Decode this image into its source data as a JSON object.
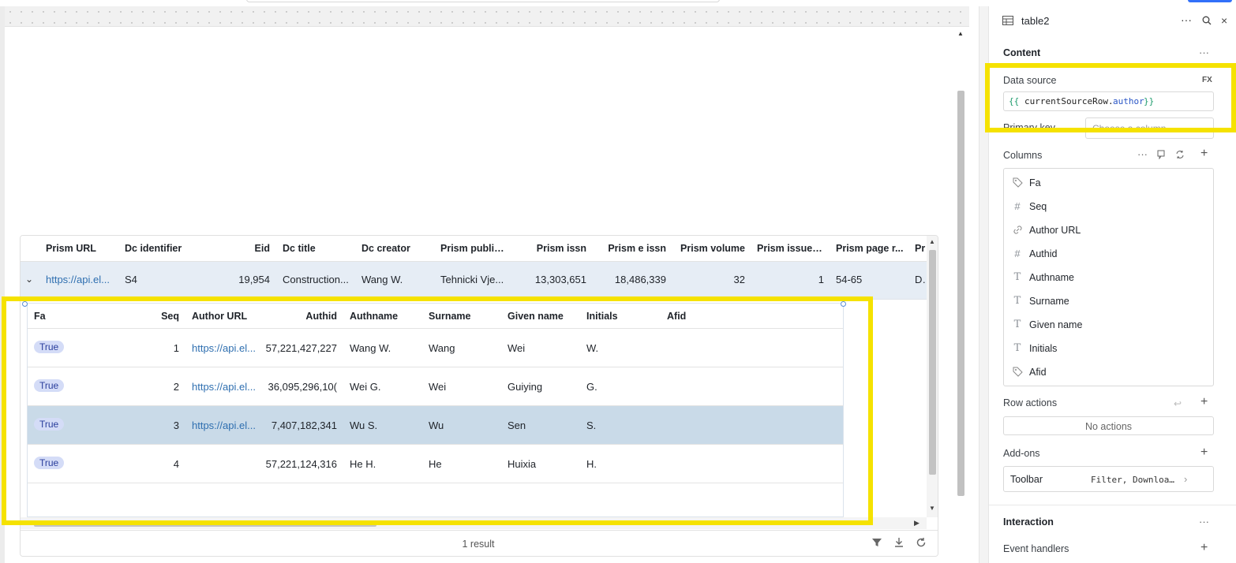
{
  "outer_table": {
    "columns": [
      "Prism URL",
      "Dc identifier",
      "Eid",
      "Dc title",
      "Dc creator",
      "Prism public...",
      "Prism issn",
      "Prism e issn",
      "Prism volume",
      "Prism issue i...",
      "Prism page r...",
      "Pr"
    ],
    "row": {
      "expand": "⌄",
      "prism_url": "https://api.el...",
      "dc_identifier": "S4",
      "eid": "19,954",
      "dc_title": "Construction...",
      "dc_creator": "Wang W.",
      "prism_public": "Tehnicki Vje...",
      "prism_issn": "13,303,651",
      "prism_e_issn": "18,486,339",
      "prism_volume": "32",
      "prism_issue": "1",
      "prism_page": "54-65",
      "pr": "De"
    },
    "footer": {
      "result_count": "1 result"
    }
  },
  "nested_table": {
    "columns": [
      "Fa",
      "Seq",
      "Author URL",
      "Authid",
      "Authname",
      "Surname",
      "Given name",
      "Initials",
      "Afid"
    ],
    "rows": [
      {
        "fa": "True",
        "seq": "1",
        "author_url": "https://api.el...",
        "authid": "57,221,427,227",
        "authname": "Wang W.",
        "surname": "Wang",
        "given": "Wei",
        "initials": "W.",
        "afid": ""
      },
      {
        "fa": "True",
        "seq": "2",
        "author_url": "https://api.el...",
        "authid": "36,095,296,10(",
        "authname": "Wei G.",
        "surname": "Wei",
        "given": "Guiying",
        "initials": "G.",
        "afid": ""
      },
      {
        "fa": "True",
        "seq": "3",
        "author_url": "https://api.el...",
        "authid": "7,407,182,341",
        "authname": "Wu S.",
        "surname": "Wu",
        "given": "Sen",
        "initials": "S.",
        "afid": ""
      },
      {
        "fa": "True",
        "seq": "4",
        "author_url": "",
        "authid": "57,221,124,316",
        "authname": "He H.",
        "surname": "He",
        "given": "Huixia",
        "initials": "H.",
        "afid": ""
      }
    ]
  },
  "panel": {
    "title": "table2",
    "content_section": "Content",
    "data_source_label": "Data source",
    "fx_label": "FX",
    "data_source_open": "{{ ",
    "data_source_obj": "currentSourceRow.",
    "data_source_prop": "author",
    "data_source_close": "}}",
    "primary_key_label": "Primary key",
    "primary_key_placeholder": "Choose a column",
    "columns_label": "Columns",
    "columns": [
      {
        "label": "Fa",
        "icon": "tag-icon"
      },
      {
        "label": "Seq",
        "icon": "hash-icon"
      },
      {
        "label": "Author URL",
        "icon": "link-icon"
      },
      {
        "label": "Authid",
        "icon": "hash-icon"
      },
      {
        "label": "Authname",
        "icon": "text-icon"
      },
      {
        "label": "Surname",
        "icon": "text-icon"
      },
      {
        "label": "Given name",
        "icon": "text-icon"
      },
      {
        "label": "Initials",
        "icon": "text-icon"
      },
      {
        "label": "Afid",
        "icon": "tag-icon"
      }
    ],
    "row_actions_label": "Row actions",
    "no_actions": "No actions",
    "addons_label": "Add-ons",
    "toolbar_label": "Toolbar",
    "toolbar_value": "Filter, Downloa...",
    "interaction_section": "Interaction",
    "event_handlers_label": "Event handlers"
  },
  "colors": {
    "highlight": "#f5e200",
    "badge_bg": "#d4dcf7",
    "selected_row": "#c9dae8",
    "link": "#2f6fb0"
  }
}
